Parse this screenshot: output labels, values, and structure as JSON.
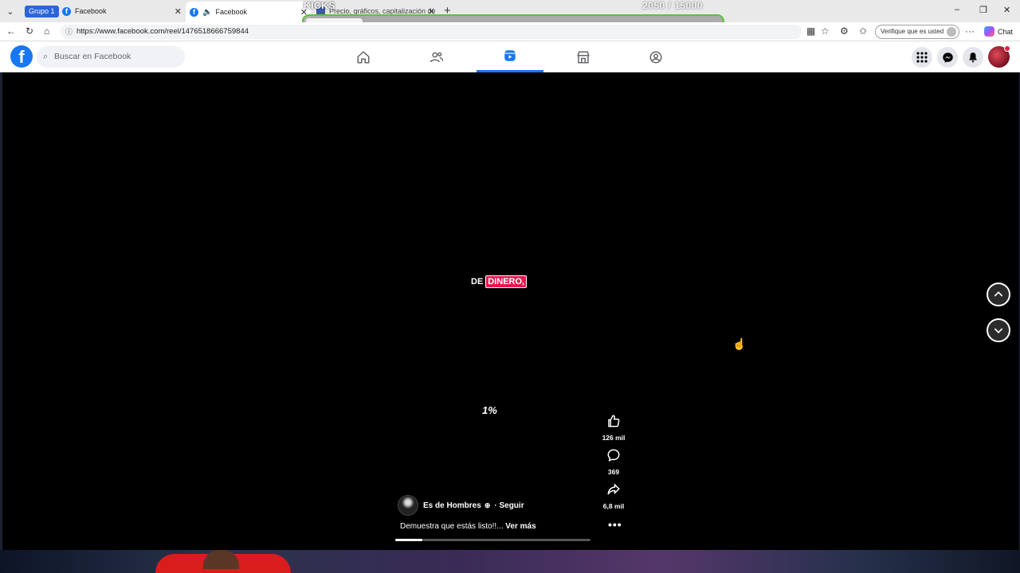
{
  "browser": {
    "group_label": "Grupo 1",
    "tabs": [
      {
        "title": "Facebook",
        "close": "✕"
      },
      {
        "title": "Facebook",
        "close": "✕"
      },
      {
        "title": "Precio, gráficos, capitalización de",
        "close": "✕"
      }
    ],
    "new_tab": "+",
    "url": "https://www.facebook.com/reel/1476518666759844",
    "verify_label": "Verifique que es usted",
    "chat_label": "Chat",
    "window": {
      "minimize": "–",
      "restore": "❐",
      "close": "✕"
    }
  },
  "overlay": {
    "kicks_label": "KICKS",
    "counter": "2050  / 15000",
    "progress_fraction": 0.1367
  },
  "facebook": {
    "search_placeholder": "Buscar en Facebook",
    "nav": [
      "home-icon",
      "friends-icon",
      "reels-icon",
      "marketplace-icon",
      "groups-icon"
    ],
    "active_nav": "reels-icon"
  },
  "reel": {
    "caption_plain": "DE",
    "caption_highlight": "DINERO,",
    "overlay_text": "1%",
    "likes": "126 mil",
    "comments": "369",
    "shares": "6,8 mil",
    "more": "•••",
    "author": "Es de Hombres",
    "follow": "· Seguir",
    "description": "Demuestra que estás listo!!...",
    "see_more": "Ver más",
    "playback_fraction": 0.14
  }
}
